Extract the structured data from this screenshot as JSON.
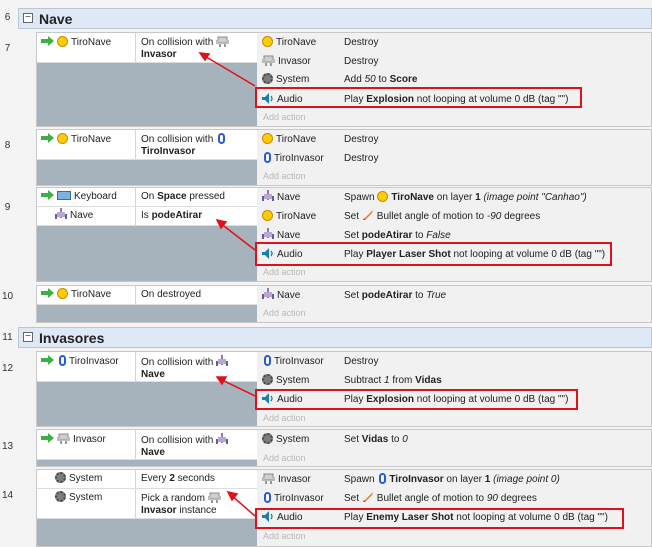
{
  "groups": [
    {
      "number": "6",
      "title": "Nave"
    },
    {
      "number": "11",
      "title": "Invasores"
    }
  ],
  "events": [
    {
      "number": "7",
      "conditions": [
        {
          "object": "TiroNave",
          "icon": "sprite-icon",
          "text": "On collision with",
          "bold": "Invasor",
          "icon2": "invader-icon"
        }
      ],
      "actions": [
        {
          "object": "TiroNave",
          "icon": "sprite-icon",
          "text": "Destroy"
        },
        {
          "object": "Invasor",
          "icon": "invader-icon",
          "text": "Destroy"
        },
        {
          "object": "System",
          "icon": "gear-icon",
          "text_parts": [
            "Add ",
            "50",
            " to ",
            "Score"
          ]
        },
        {
          "object": "Audio",
          "icon": "audio-icon",
          "text_parts": [
            "Play ",
            "Explosion",
            " not looping at volume 0 dB (tag \"\")"
          ],
          "highlighted": true
        }
      ],
      "add_action": "Add action"
    },
    {
      "number": "8",
      "conditions": [
        {
          "object": "TiroNave",
          "icon": "sprite-icon",
          "text": "On collision with",
          "bold": "TiroInvasor",
          "icon2": "shot-icon"
        }
      ],
      "actions": [
        {
          "object": "TiroNave",
          "icon": "sprite-icon",
          "text": "Destroy"
        },
        {
          "object": "TiroInvasor",
          "icon": "shot-icon",
          "text": "Destroy"
        }
      ],
      "add_action": "Add action"
    },
    {
      "number": "9",
      "conditions": [
        {
          "object": "Keyboard",
          "icon": "keyboard-icon",
          "text_parts": [
            "On ",
            "Space",
            " pressed"
          ]
        },
        {
          "object": "Nave",
          "icon": "ship-icon",
          "text_parts": [
            "Is ",
            "podeAtirar"
          ]
        }
      ],
      "actions": [
        {
          "object": "Nave",
          "icon": "ship-icon",
          "text_parts": [
            "Spawn ",
            "TiroNave",
            " on layer ",
            "1",
            " (image point \"Canhao\")"
          ]
        },
        {
          "object": "TiroNave",
          "icon": "sprite-icon",
          "text_parts": [
            "Set ",
            "Bullet angle of motion to ",
            "-90",
            " degrees"
          ]
        },
        {
          "object": "Nave",
          "icon": "ship-icon",
          "text_parts": [
            "Set ",
            "podeAtirar",
            " to ",
            "False"
          ]
        },
        {
          "object": "Audio",
          "icon": "audio-icon",
          "text_parts": [
            "Play ",
            "Player Laser Shot",
            " not looping at volume 0 dB (tag \"\")"
          ],
          "highlighted": true
        }
      ],
      "add_action": "Add action"
    },
    {
      "number": "10",
      "conditions": [
        {
          "object": "TiroNave",
          "icon": "sprite-icon",
          "text": "On destroyed"
        }
      ],
      "actions": [
        {
          "object": "Nave",
          "icon": "ship-icon",
          "text_parts": [
            "Set ",
            "podeAtirar",
            " to ",
            "True"
          ]
        }
      ],
      "add_action": "Add action"
    },
    {
      "number": "12",
      "conditions": [
        {
          "object": "TiroInvasor",
          "icon": "shot-icon",
          "text": "On collision with",
          "bold": "Nave",
          "icon2": "ship-icon"
        }
      ],
      "actions": [
        {
          "object": "TiroInvasor",
          "icon": "shot-icon",
          "text": "Destroy"
        },
        {
          "object": "System",
          "icon": "gear-icon",
          "text_parts": [
            "Subtract ",
            "1",
            " from ",
            "Vidas"
          ]
        },
        {
          "object": "Audio",
          "icon": "audio-icon",
          "text_parts": [
            "Play ",
            "Explosion",
            " not looping at volume 0 dB (tag \"\")"
          ],
          "highlighted": true
        }
      ],
      "add_action": "Add action"
    },
    {
      "number": "13",
      "conditions": [
        {
          "object": "Invasor",
          "icon": "invader-icon",
          "text": "On collision with",
          "bold": "Nave",
          "icon2": "ship-icon"
        }
      ],
      "actions": [
        {
          "object": "System",
          "icon": "gear-icon",
          "text_parts": [
            "Set ",
            "Vidas",
            " to ",
            "0"
          ]
        }
      ],
      "add_action": "Add action"
    },
    {
      "number": "14",
      "conditions": [
        {
          "object": "System",
          "icon": "gear-icon",
          "text_parts": [
            "Every ",
            "2",
            " seconds"
          ]
        },
        {
          "object": "System",
          "icon": "gear-icon",
          "text": "Pick a random",
          "bold": "Invasor",
          "suffix": " instance",
          "icon2": "invader-icon"
        }
      ],
      "actions": [
        {
          "object": "Invasor",
          "icon": "invader-icon",
          "text_parts": [
            "Spawn ",
            "TiroInvasor",
            " on layer ",
            "1",
            " (image point 0)"
          ]
        },
        {
          "object": "TiroInvasor",
          "icon": "shot-icon",
          "text_parts": [
            "Set ",
            "Bullet angle of motion to ",
            "90",
            " degrees"
          ]
        },
        {
          "object": "Audio",
          "icon": "audio-icon",
          "text_parts": [
            "Play ",
            "Enemy Laser Shot",
            " not looping at volume 0 dB (tag \"\")"
          ],
          "highlighted": true
        }
      ],
      "add_action": "Add action"
    }
  ],
  "colors": {
    "highlight": "#e0111a",
    "group_bg": "#dfe9f5",
    "condition_block": "#a7b3bc"
  }
}
